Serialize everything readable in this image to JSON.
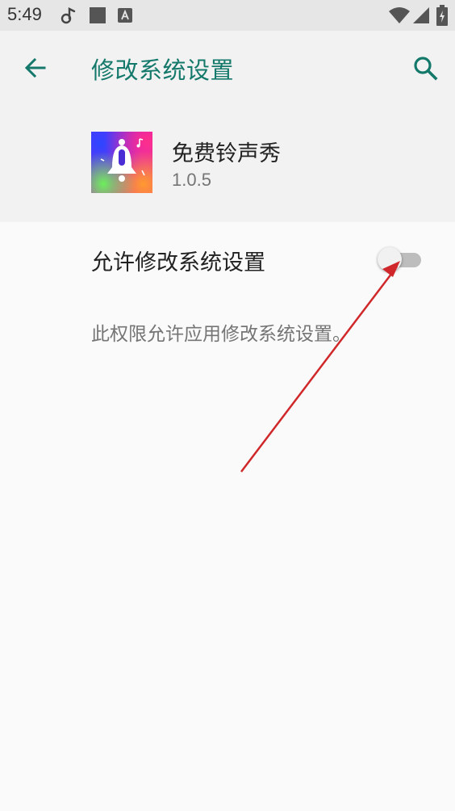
{
  "status_bar": {
    "time": "5:49",
    "icons": [
      "music-note-icon",
      "square-notification-icon",
      "text-notification-icon",
      "wifi-icon",
      "signal-icon",
      "battery-icon"
    ]
  },
  "header": {
    "title": "修改系统设置",
    "back_icon": "back-arrow-icon",
    "search_icon": "search-icon"
  },
  "app": {
    "name": "免费铃声秀",
    "version": "1.0.5",
    "icon": "bell-app-icon"
  },
  "setting": {
    "label": "允许修改系统设置",
    "toggle_on": false,
    "description": "此权限允许应用修改系统设置。"
  },
  "colors": {
    "accent": "#14796b",
    "header_bg": "#f2f2f2",
    "body_bg": "#fafafa",
    "status_bar_bg": "#e6e6e6",
    "annotation_arrow": "#d0282a"
  }
}
